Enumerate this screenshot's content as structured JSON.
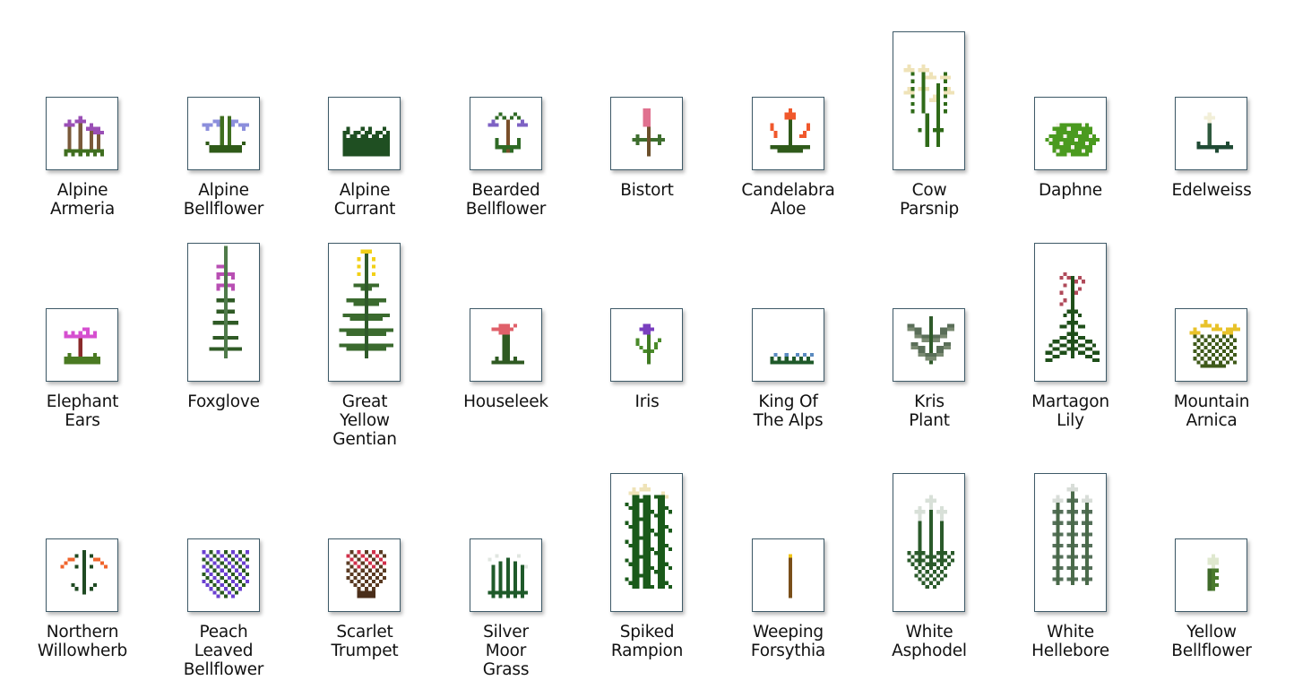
{
  "items": [
    {
      "name": "Alpine Armeria",
      "lines": [
        "Alpine",
        "Armeria"
      ],
      "size": "small",
      "colors": {
        "flower": "#9a4fb5",
        "stem": "#7a5a3a",
        "leaf": "#3f6e1f"
      }
    },
    {
      "name": "Alpine Bellflower",
      "lines": [
        "Alpine",
        "Bellflower"
      ],
      "size": "small",
      "colors": {
        "flower": "#8c8fdc",
        "stem": "#3f6e1f",
        "leaf": "#2f5a18"
      }
    },
    {
      "name": "Alpine Currant",
      "lines": [
        "Alpine",
        "Currant"
      ],
      "size": "small",
      "colors": {
        "flower": "#ffffff",
        "stem": "#1f4f22",
        "leaf": "#1f4f22"
      }
    },
    {
      "name": "Bearded Bellflower",
      "lines": [
        "Bearded",
        "Bellflower"
      ],
      "size": "small",
      "colors": {
        "flower": "#7e62c4",
        "stem": "#7a4f2a",
        "leaf": "#2f6a25"
      }
    },
    {
      "name": "Bistort",
      "lines": [
        "Bistort"
      ],
      "size": "small",
      "colors": {
        "flower": "#e0718f",
        "stem": "#6b4f2a",
        "leaf": "#3e6e2e"
      }
    },
    {
      "name": "Candelabra Aloe",
      "lines": [
        "Candelabra",
        "Aloe"
      ],
      "size": "small",
      "colors": {
        "flower": "#f0582c",
        "stem": "#2f5a1a",
        "leaf": "#2f5a1a"
      }
    },
    {
      "name": "Cow Parsnip",
      "lines": [
        "Cow",
        "Parsnip"
      ],
      "size": "tall",
      "colors": {
        "flower": "#efe3b8",
        "stem": "#2f6a18",
        "leaf": "#2f6a18"
      }
    },
    {
      "name": "Daphne",
      "lines": [
        "Daphne"
      ],
      "size": "small",
      "colors": {
        "flower": "#f4f1ea",
        "stem": "#3f8a1a",
        "leaf": "#4a9a1f"
      }
    },
    {
      "name": "Edelweiss",
      "lines": [
        "Edelweiss"
      ],
      "size": "small",
      "colors": {
        "flower": "#f2efd8",
        "stem": "#2f5a3e",
        "leaf": "#1f4a34"
      }
    },
    {
      "name": "Elephant Ears",
      "lines": [
        "Elephant",
        "Ears"
      ],
      "size": "small",
      "colors": {
        "flower": "#d64fd0",
        "stem": "#8a2a2a",
        "leaf": "#4a7a22"
      }
    },
    {
      "name": "Foxglove",
      "lines": [
        "Foxglove"
      ],
      "size": "tall",
      "colors": {
        "flower": "#b84fb3",
        "stem": "#4f7a4a",
        "leaf": "#2f5a25"
      }
    },
    {
      "name": "Great Yellow Gentian",
      "lines": [
        "Great",
        "Yellow",
        "Gentian"
      ],
      "size": "tall",
      "colors": {
        "flower": "#f2d017",
        "stem": "#2f5a2a",
        "leaf": "#3a6a2e"
      }
    },
    {
      "name": "Houseleek",
      "lines": [
        "Houseleek"
      ],
      "size": "small",
      "colors": {
        "flower": "#e0606a",
        "stem": "#2f5a22",
        "leaf": "#2f5a22"
      }
    },
    {
      "name": "Iris",
      "lines": [
        "Iris"
      ],
      "size": "small",
      "colors": {
        "flower": "#7a3fbf",
        "stem": "#3f7a22",
        "leaf": "#4a8a2a"
      }
    },
    {
      "name": "King Of The Alps",
      "lines": [
        "King Of",
        "The Alps"
      ],
      "size": "small",
      "colors": {
        "flower": "#5a8ac0",
        "stem": "#1f5a2a",
        "leaf": "#1f5a2a"
      }
    },
    {
      "name": "Kris Plant",
      "lines": [
        "Kris",
        "Plant"
      ],
      "size": "small",
      "colors": {
        "flower": "#7a8a72",
        "stem": "#2f5a2a",
        "leaf": "#5a6e58"
      }
    },
    {
      "name": "Martagon Lily",
      "lines": [
        "Martagon",
        "Lily"
      ],
      "size": "tall",
      "colors": {
        "flower": "#b04a5a",
        "stem": "#1f4f1a",
        "leaf": "#1f4f1a"
      }
    },
    {
      "name": "Mountain Arnica",
      "lines": [
        "Mountain",
        "Arnica"
      ],
      "size": "small",
      "colors": {
        "flower": "#e8c22a",
        "stem": "#3f5a1a",
        "leaf": "#3f5a1a"
      }
    },
    {
      "name": "Northern Willowherb",
      "lines": [
        "Northern",
        "Willowherb"
      ],
      "size": "small",
      "colors": {
        "flower": "#f0642c",
        "stem": "#1f4a22",
        "leaf": "#1f4a22"
      }
    },
    {
      "name": "Peach Leaved Bellflower",
      "lines": [
        "Peach",
        "Leaved",
        "Bellflower"
      ],
      "size": "small",
      "colors": {
        "flower": "#6a3fd0",
        "stem": "#1f4f1a",
        "leaf": "#2a5a1f"
      }
    },
    {
      "name": "Scarlet Trumpet",
      "lines": [
        "Scarlet",
        "Trumpet"
      ],
      "size": "small",
      "colors": {
        "flower": "#d0304a",
        "stem": "#5a3a22",
        "leaf": "#4a2e1a"
      }
    },
    {
      "name": "Silver Moor Grass",
      "lines": [
        "Silver",
        "Moor",
        "Grass"
      ],
      "size": "small",
      "colors": {
        "flower": "#e0e6e0",
        "stem": "#1f5a2a",
        "leaf": "#1f5a2a"
      }
    },
    {
      "name": "Spiked Rampion",
      "lines": [
        "Spiked",
        "Rampion"
      ],
      "size": "tall",
      "colors": {
        "flower": "#efe3b8",
        "stem": "#1a5a1a",
        "leaf": "#1a5a1a"
      }
    },
    {
      "name": "Weeping Forsythia",
      "lines": [
        "Weeping",
        "Forsythia"
      ],
      "size": "small",
      "colors": {
        "flower": "#f0c417",
        "stem": "#7a4f1a",
        "leaf": "#c49a17"
      }
    },
    {
      "name": "White Asphodel",
      "lines": [
        "White",
        "Asphodel"
      ],
      "size": "tall",
      "colors": {
        "flower": "#d8e0d8",
        "stem": "#2a5a2a",
        "leaf": "#2a5a2a"
      }
    },
    {
      "name": "White Hellebore",
      "lines": [
        "White",
        "Hellebore"
      ],
      "size": "tall",
      "colors": {
        "flower": "#d8ddd8",
        "stem": "#4a6a4a",
        "leaf": "#56705a"
      }
    },
    {
      "name": "Yellow Bellflower",
      "lines": [
        "Yellow",
        "Bellflower"
      ],
      "size": "small",
      "colors": {
        "flower": "#dfe8cf",
        "stem": "#3f6a2a",
        "leaf": "#4a7a2e"
      }
    }
  ]
}
